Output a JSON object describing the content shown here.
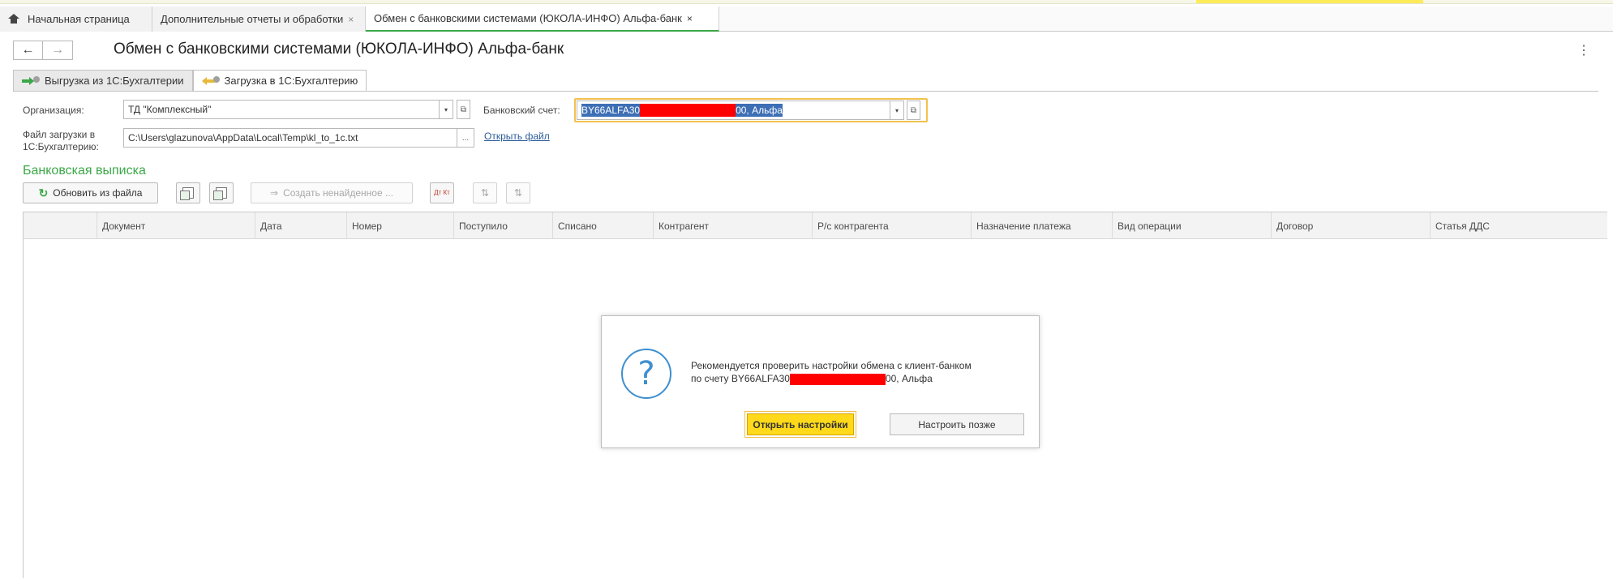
{
  "tabs": {
    "home": "Начальная страница",
    "reports": "Дополнительные отчеты и обработки",
    "exchange": "Обмен с банковскими системами (ЮКОЛА-ИНФО) Альфа-банк",
    "close": "×"
  },
  "nav": {
    "back": "←",
    "forward": "→"
  },
  "header": {
    "title": "Обмен с банковскими системами (ЮКОЛА-ИНФО) Альфа-банк",
    "more": "⋮"
  },
  "subtabs": {
    "export": "Выгрузка из 1С:Бухгалтерии",
    "import": "Загрузка в 1С:Бухгалтерию"
  },
  "form": {
    "org_label": "Организация:",
    "org_value": "ТД \"Комплексный\"",
    "account_label": "Банковский счет:",
    "account_prefix": "BY66ALFA30",
    "account_suffix": "00, Альфа",
    "file_label_1": "Файл загрузки в",
    "file_label_2": "1С:Бухгалтерию:",
    "file_value": "C:\\Users\\glazunova\\AppData\\Local\\Temp\\kl_to_1c.txt",
    "file_btn": "...",
    "open_file": "Открыть файл"
  },
  "section": {
    "title": "Банковская выписка"
  },
  "toolbar": {
    "refresh": "Обновить из файла",
    "create": "Создать ненайденное ...",
    "dtkt": "Дт Кт"
  },
  "table": {
    "columns": [
      "Документ",
      "Дата",
      "Номер",
      "Поступило",
      "Списано",
      "Контрагент",
      "Р/с контрагента",
      "Назначение платежа",
      "Вид операции",
      "Договор",
      "Статья ДДС"
    ]
  },
  "dialog": {
    "line1": "Рекомендуется проверить настройки обмена с клиент-банком",
    "line2_prefix": "по счету BY66ALFA30",
    "line2_suffix": "00, Альфа",
    "primary": "Открыть настройки",
    "secondary": "Настроить позже"
  },
  "colors": {
    "accent_green": "#3aa847",
    "highlight_yellow": "#ffd91a",
    "selection_blue": "#3d6fb5",
    "redaction_red": "#ff0000"
  }
}
